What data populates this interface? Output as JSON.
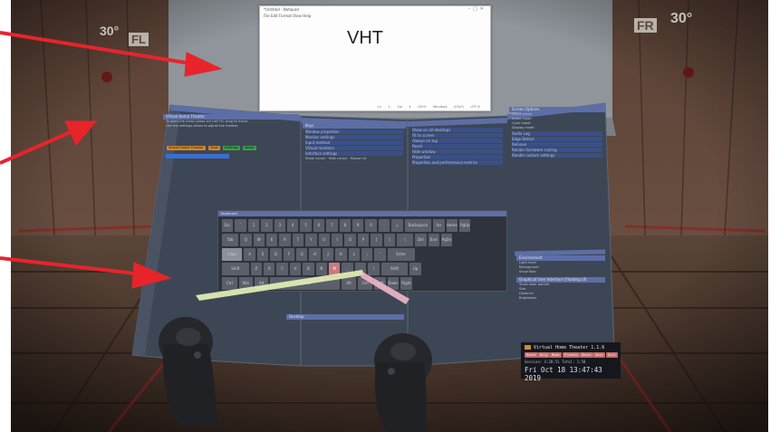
{
  "notepad": {
    "window_title": "*Untitled - Notepad",
    "menu": [
      "File",
      "Edit",
      "Format",
      "View",
      "Help"
    ],
    "content": "VHT",
    "status": [
      "Ln 1, Col 4",
      "100%",
      "Windows (CRLF)",
      "UTF-8"
    ]
  },
  "wall_signs": {
    "left_angle": "30°",
    "left": "FL",
    "right": "FR",
    "right_angle": "30°"
  },
  "panels": {
    "left_header": "Virtual Home Theater",
    "left_links": [
      "Virtual Home Theater",
      "Tools",
      "Settings",
      "About"
    ],
    "mid1_header": "Keys",
    "mid1_items": [
      "Window properties",
      "Monitor settings",
      "Input method",
      "Virtual monitors",
      "Interface settings"
    ],
    "mid1_buttons": [
      "Show cursor",
      "Hide cursor",
      "Mouse hit"
    ],
    "mid2_items": [
      "Show on all desktops",
      "Fit to screen",
      "Always on top",
      "Reset",
      "Hide window",
      "Properties"
    ],
    "mid2_footer": "Properties and performance metrics",
    "right_header": "Screen Options",
    "right_items": [
      "Game mode",
      "Audio mode",
      "Color mode",
      "Display mode",
      "Audio Lag",
      "Edge Detect",
      "Remove",
      "Render hardware scaling",
      "Render custom settings",
      "Virtual display and performance metrics"
    ],
    "bottom_small_header": "Desktop",
    "environment_header": "Environment",
    "environment_rows": [
      "Light level",
      "Background",
      "Show floor",
      "Flip",
      "Cinema mode"
    ],
    "interface_header": "Graphical User Interface (Floating UI)",
    "interface_rows": [
      "Show laser pointer",
      "Mouse clicks",
      "Mouse lock",
      "Anchor",
      "Size",
      "Distance",
      "Brightness",
      "Opacity"
    ]
  },
  "keyboard": {
    "header": "Keyboard",
    "row1": [
      "Esc",
      "`",
      "1",
      "2",
      "3",
      "4",
      "5",
      "6",
      "7",
      "8",
      "9",
      "0",
      "-",
      "=",
      "Backspace",
      "Ins",
      "Home",
      "PgUp"
    ],
    "row2": [
      "Tab",
      "Q",
      "W",
      "E",
      "R",
      "T",
      "Y",
      "U",
      "I",
      "O",
      "P",
      "[",
      "]",
      "\\",
      "Del",
      "End",
      "PgDn"
    ],
    "row3": [
      "Caps",
      "A",
      "S",
      "D",
      "F",
      "G",
      "H",
      "J",
      "K",
      "L",
      ";",
      "'",
      "Enter"
    ],
    "row4": [
      "Shift",
      "Z",
      "X",
      "C",
      "V",
      "B",
      "N",
      "M",
      ",",
      ".",
      "/",
      "Shift",
      "Up"
    ],
    "row5": [
      "Ctrl",
      "Win",
      "Alt",
      "Space",
      "Alt",
      "Ctrl",
      "Left",
      "Down",
      "Right"
    ],
    "pressed": "M"
  },
  "vht_panel": {
    "title": "Virtual Home Theater 1.1.6",
    "buttons": [
      "Reset",
      "Help",
      "Mode",
      "Presets",
      "Reset",
      "Save",
      "Exit"
    ],
    "session": "Session: 4:20:51  Total: 1:58",
    "datetime": "Fri Oct 18 13:47:43 2019"
  },
  "colors": {
    "annotation_arrow": "#e8242b",
    "panel_header": "#5d6ea6",
    "panel_bg": "#3b4452"
  }
}
